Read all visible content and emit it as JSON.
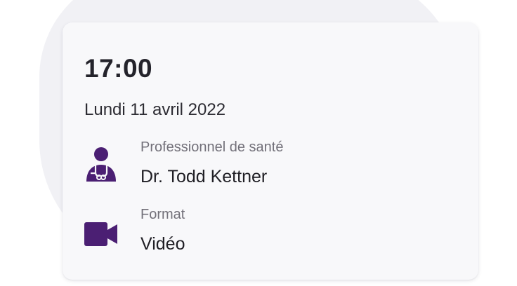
{
  "appointment": {
    "time": "17:00",
    "date": "Lundi 11 avril 2022",
    "practitioner": {
      "label": "Professionnel de santé",
      "value": "Dr. Todd Kettner",
      "icon": "doctor-icon"
    },
    "format": {
      "label": "Format",
      "value": "Vidéo",
      "icon": "video-camera-icon"
    }
  },
  "colors": {
    "accent": "#4b1f73",
    "card_background": "#f8f8fa",
    "page_background": "#f1f1f5"
  }
}
